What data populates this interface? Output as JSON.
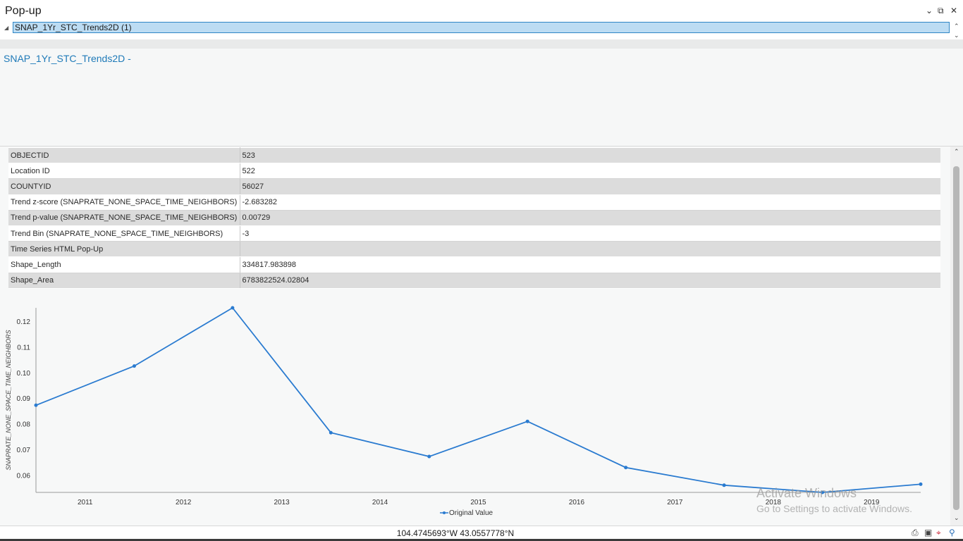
{
  "window": {
    "title": "Pop-up",
    "chevron_icon": "chevron-down-icon",
    "float_icon": "restore-window-icon",
    "close_icon": "close-icon"
  },
  "feature_list": {
    "items": [
      {
        "label": "SNAP_1Yr_STC_Trends2D (1)",
        "selected": true
      }
    ]
  },
  "popup": {
    "title": "SNAP_1Yr_STC_Trends2D -"
  },
  "attributes": [
    {
      "field": "OBJECTID",
      "value": "523"
    },
    {
      "field": "Location ID",
      "value": "522"
    },
    {
      "field": "COUNTYID",
      "value": "56027"
    },
    {
      "field": "Trend z-score (SNAPRATE_NONE_SPACE_TIME_NEIGHBORS)",
      "value": "-2.683282"
    },
    {
      "field": "Trend p-value (SNAPRATE_NONE_SPACE_TIME_NEIGHBORS)",
      "value": "0.00729"
    },
    {
      "field": "Trend Bin (SNAPRATE_NONE_SPACE_TIME_NEIGHBORS)",
      "value": "-3"
    },
    {
      "field": "Time Series HTML Pop-Up",
      "value": ""
    },
    {
      "field": "Shape_Length",
      "value": "334817.983898"
    },
    {
      "field": "Shape_Area",
      "value": "6783822524.02804"
    }
  ],
  "chart_data": {
    "type": "line",
    "title": "",
    "xlabel": "",
    "ylabel": "SNAPRATE_NONE_SPACE_TIME_NEIGHBORS",
    "x_ticks": [
      "2011",
      "2012",
      "2013",
      "2014",
      "2015",
      "2016",
      "2017",
      "2018",
      "2019"
    ],
    "y_ticks": [
      "0.12",
      "0.11",
      "0.10",
      "0.09",
      "0.08",
      "0.07",
      "0.06"
    ],
    "ylim": [
      0.0535,
      0.1255
    ],
    "xlim": [
      2010.5,
      2019.5
    ],
    "series": [
      {
        "name": "Original Value",
        "color": "#2a7bd0",
        "x": [
          2010.5,
          2011.5,
          2012.5,
          2013.5,
          2014.5,
          2015.5,
          2016.5,
          2017.5,
          2018.5,
          2019.5
        ],
        "y": [
          0.0875,
          0.1028,
          0.1255,
          0.0768,
          0.0675,
          0.0812,
          0.0632,
          0.0563,
          0.0535,
          0.0567
        ]
      }
    ],
    "legend_position": "bottom-center",
    "grid": false
  },
  "watermark": {
    "line1": "Activate Windows",
    "line2": "Go to Settings to activate Windows."
  },
  "status": {
    "coordinates": "104.4745693°W 43.0557778°N",
    "icons": [
      "print-icon",
      "pan-to-icon",
      "flash-icon",
      "zoom-to-icon"
    ]
  }
}
